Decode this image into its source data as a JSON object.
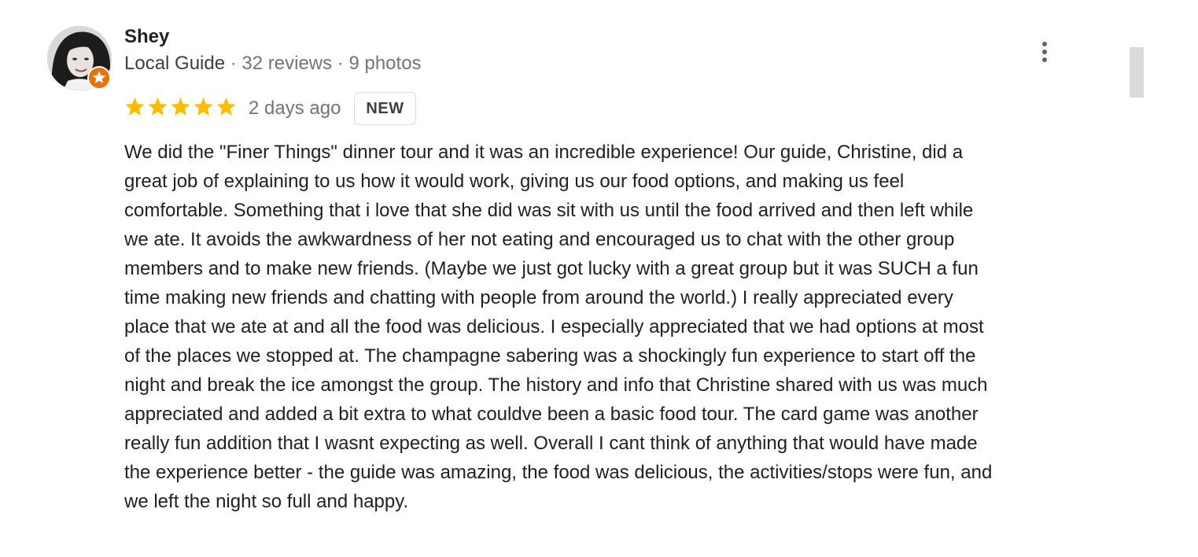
{
  "review": {
    "author": {
      "name": "Shey",
      "guide_label": "Local Guide",
      "reviews": "32 reviews",
      "photos": "9 photos",
      "separator": " · "
    },
    "rating": {
      "stars": 5,
      "max_stars": 5,
      "star_color": "#fbbc04"
    },
    "date": "2 days ago",
    "badge": "NEW",
    "body_lines": [
      "We did the \"Finer Things\" dinner tour and it was an incredible experience! Our guide, Christine, did a",
      "great job of explaining to us how it would work, giving us our food options, and making us feel",
      "comfortable. Something that i love that she did was sit with us until the food arrived and then left while",
      "we ate. It avoids the awkwardness of her not eating and encouraged us to chat with the other group",
      "members and to make new friends. (Maybe we just got lucky with a great group but it was SUCH a fun",
      "time making new friends and chatting with people from around the world.) I really appreciated every",
      "place that we ate at and all the food was delicious. I especially appreciated that we had options at most",
      "of the places we stopped at. The champagne sabering was a shockingly fun experience to start off the",
      "night and break the ice amongst the group. The history and info that Christine shared with us was much",
      "appreciated and added a bit extra to what couldve been a basic food tour. The card game was another",
      "really fun addition that I wasnt expecting as well. Overall I cant think of anything that would have made",
      "the experience better - the guide was amazing, the food was delicious, the activities/stops were fun, and",
      "we left the night so full and happy."
    ]
  },
  "icons": {
    "more_menu": "more-vert-icon",
    "guide_badge": "local-guide-star-icon",
    "star": "star-icon"
  },
  "colors": {
    "guide_badge": "#e8710a",
    "meta_text": "#70757a",
    "scrollbar": "#dadada"
  }
}
